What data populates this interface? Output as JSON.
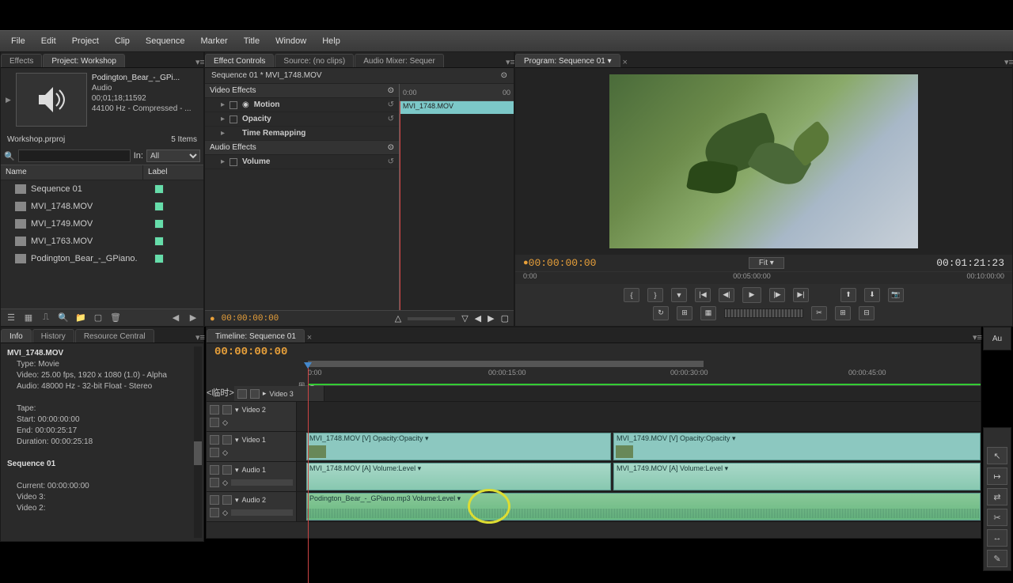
{
  "menu": [
    "File",
    "Edit",
    "Project",
    "Clip",
    "Sequence",
    "Marker",
    "Title",
    "Window",
    "Help"
  ],
  "project": {
    "tabs": [
      "Effects",
      "Project: Workshop"
    ],
    "clip_name": "Podington_Bear_-_GPi...",
    "clip_type": "Audio",
    "clip_tc": "00;01;18;11592",
    "clip_fmt": "44100 Hz - Compressed - ...",
    "proj_file": "Workshop.prproj",
    "item_count": "5 Items",
    "in_label": "In:",
    "in_value": "All",
    "col_name": "Name",
    "col_label": "Label",
    "items": [
      {
        "name": "Sequence 01"
      },
      {
        "name": "MVI_1748.MOV"
      },
      {
        "name": "MVI_1749.MOV"
      },
      {
        "name": "MVI_1763.MOV"
      },
      {
        "name": "Podington_Bear_-_GPiano."
      }
    ]
  },
  "effect_controls": {
    "tabs": [
      "Effect Controls",
      "Source: (no clips)",
      "Audio Mixer: Sequer"
    ],
    "breadcrumb": "Sequence 01 * MVI_1748.MOV",
    "clip_label": "MVI_1748.MOV",
    "time_start": "0:00",
    "time_end": "00",
    "video_section": "Video Effects",
    "video_items": [
      "Motion",
      "Opacity",
      "Time Remapping"
    ],
    "audio_section": "Audio Effects",
    "audio_items": [
      "Volume"
    ],
    "footer_tc": "00:00:00:00"
  },
  "program": {
    "tab": "Program: Sequence 01",
    "tc_left": "00:00:00:00",
    "fit": "Fit",
    "tc_right": "00:01:21:23",
    "ruler": [
      "0:00",
      "00:05:00:00",
      "00:10:00:00"
    ]
  },
  "timeline": {
    "tab": "Timeline: Sequence 01",
    "tc": "00:00:00:00",
    "ruler": [
      "0:00",
      "00:00:15:00",
      "00:00:30:00",
      "00:00:45:00"
    ],
    "tracks": {
      "v3": "Video 3",
      "v2": "Video 2",
      "v1": "Video 1",
      "a1": "Audio 1",
      "a2": "Audio 2"
    },
    "clips": {
      "v1a": "MVI_1748.MOV [V] Opacity:Opacity ▾",
      "v1b": "MVI_1749.MOV [V] Opacity:Opacity ▾",
      "a1a": "MVI_1748.MOV [A] Volume:Level ▾",
      "a1b": "MVI_1749.MOV [A] Volume:Level ▾",
      "a2": "Podington_Bear_-_GPiano.mp3 Volume:Level ▾"
    }
  },
  "info": {
    "tabs": [
      "Info",
      "History",
      "Resource Central"
    ],
    "name": "MVI_1748.MOV",
    "type": "Type: Movie",
    "video": "Video: 25.00 fps, 1920 x 1080 (1.0) - Alpha",
    "audio": "Audio: 48000 Hz - 32-bit Float - Stereo",
    "tape": "Tape:",
    "start": "Start: 00:00:00:00",
    "end": "End: 00:00:25:17",
    "dur": "Duration: 00:00:25:18",
    "seq": "Sequence 01",
    "current": "Current: 00:00:00:00",
    "v3": "Video 3:",
    "v2": "Video 2:"
  },
  "audio_tab": "Au"
}
